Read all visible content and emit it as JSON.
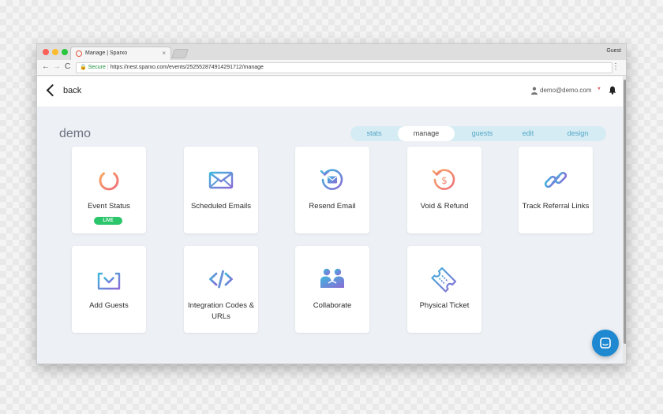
{
  "browser": {
    "tab_title": "Manage | Sparxo",
    "tab_close": "×",
    "profile": "Guest",
    "back_arrow": "←",
    "forward_arrow": "→",
    "reload": "C",
    "secure_label": "Secure",
    "url": "https://nest.sparxo.com/events/252552874914291712/manage",
    "menu": "⋮"
  },
  "header": {
    "back_label": "back",
    "user_email": "demo@demo.com",
    "caret": "▼"
  },
  "event": {
    "title": "demo"
  },
  "tabs": [
    {
      "label": "stats",
      "active": false
    },
    {
      "label": "manage",
      "active": true
    },
    {
      "label": "guests",
      "active": false
    },
    {
      "label": "edit",
      "active": false
    },
    {
      "label": "design",
      "active": false
    }
  ],
  "cards": [
    {
      "label": "Event Status",
      "icon": "power-icon",
      "badge": "LIVE"
    },
    {
      "label": "Scheduled Emails",
      "icon": "envelope-icon"
    },
    {
      "label": "Resend Email",
      "icon": "resend-email-icon"
    },
    {
      "label": "Void & Refund",
      "icon": "refund-icon"
    },
    {
      "label": "Track Referral Links",
      "icon": "link-icon"
    },
    {
      "label": "Add Guests",
      "icon": "download-tray-icon"
    },
    {
      "label": "Integration Codes & URLs",
      "icon": "code-icon"
    },
    {
      "label": "Collaborate",
      "icon": "people-icon"
    },
    {
      "label": "Physical Ticket",
      "icon": "ticket-icon"
    }
  ],
  "colors": {
    "accent": "#52a7c6",
    "tab_background": "#d6ecf4",
    "live_badge": "#2bc56b",
    "chat_button": "#1e88d1",
    "icon_gradient_start": "#3fb6dc",
    "icon_gradient_end": "#8a6bd6",
    "icon_warm_start": "#f7a863",
    "icon_warm_end": "#ef6d7a"
  }
}
